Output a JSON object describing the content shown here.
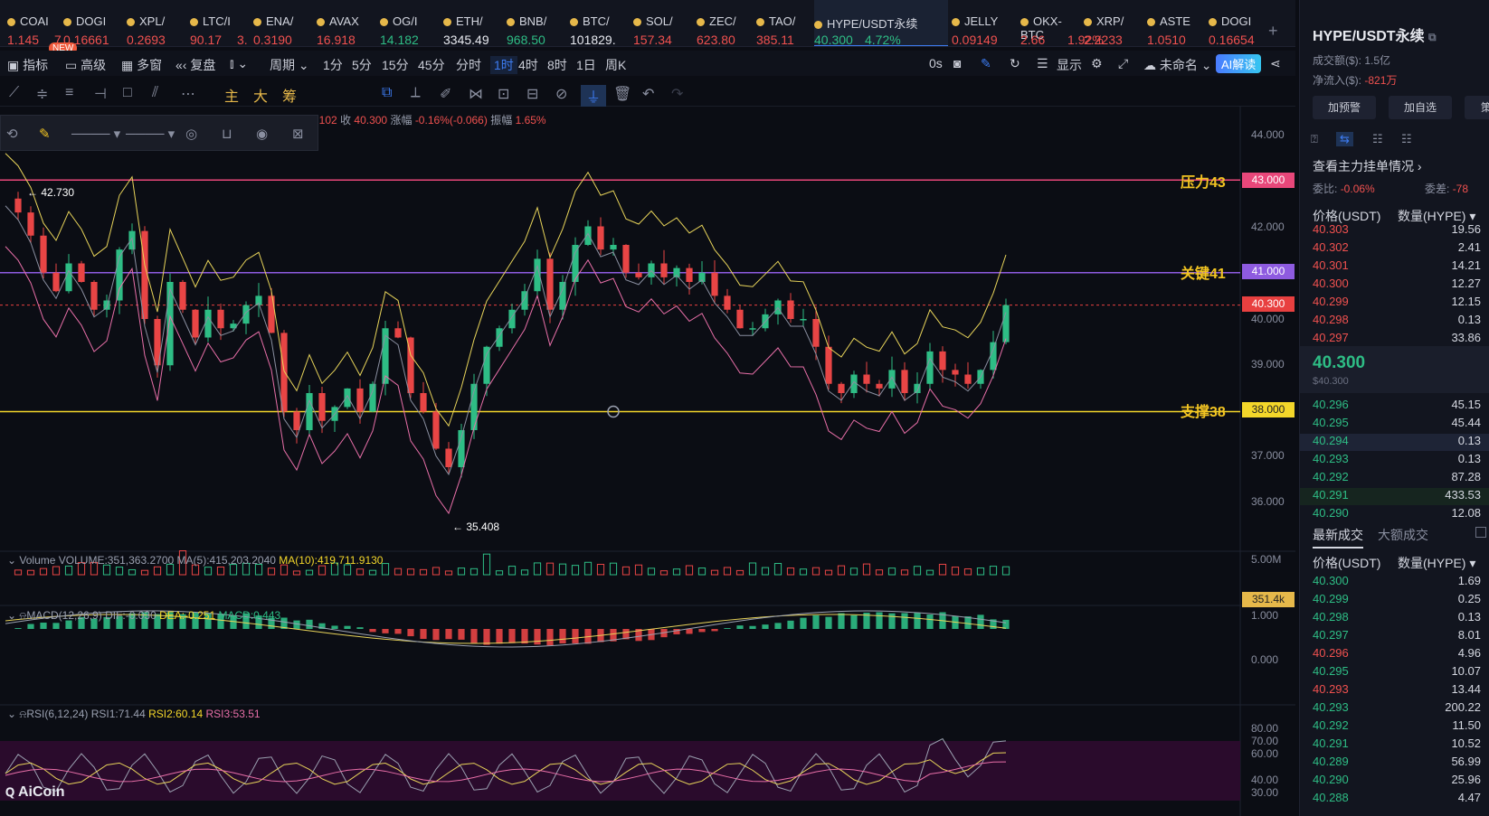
{
  "ticker": [
    {
      "sym": "COAI",
      "price": "1.145",
      "extra": "7",
      "color": "red"
    },
    {
      "sym": "DOGI",
      "price": "0.16661",
      "color": "red"
    },
    {
      "sym": "XPL/",
      "price": "0.2693",
      "color": "red"
    },
    {
      "sym": "LTC/I",
      "price": "90.17",
      "extra": "3.",
      "color": "red"
    },
    {
      "sym": "ENA/",
      "price": "0.3190",
      "color": "red"
    },
    {
      "sym": "AVAX",
      "price": "16.918",
      "color": "red"
    },
    {
      "sym": "OG/I",
      "price": "14.182",
      "color": "green"
    },
    {
      "sym": "ETH/",
      "price": "3345.49",
      "color": "white"
    },
    {
      "sym": "BNB/",
      "price": "968.50",
      "color": "green"
    },
    {
      "sym": "BTC/",
      "price": "101829.",
      "color": "white"
    },
    {
      "sym": "SOL/",
      "price": "157.34",
      "color": "red"
    },
    {
      "sym": "ZEC/",
      "price": "623.80",
      "color": "red"
    },
    {
      "sym": "TAO/",
      "price": "385.11",
      "color": "red"
    },
    {
      "sym": "HYPE/USDT永续",
      "price": "40.300",
      "extra": "4.72%",
      "color": "green",
      "active": true
    },
    {
      "sym": "JELLY",
      "price": "0.09149",
      "color": "red"
    },
    {
      "sym": "OKX-BTC",
      "price": "2.66",
      "extra": "1.92%",
      "color": "red"
    },
    {
      "sym": "XRP/",
      "price": "2.2233",
      "color": "red"
    },
    {
      "sym": "ASTE",
      "price": "1.0510",
      "color": "red"
    },
    {
      "sym": "DOGI",
      "price": "0.16654",
      "color": "red"
    }
  ],
  "new_badge": "NEW",
  "toolbar1": {
    "indicators": "指标",
    "advanced": "高级",
    "multi": "多窗",
    "replay": "复盘",
    "period": "周期",
    "intervals": [
      "1分",
      "5分",
      "15分",
      "45分",
      "分时",
      "1时",
      "4时",
      "8时",
      "1日",
      "周K"
    ],
    "selected_interval": "1时",
    "countdown": "0s",
    "display": "显示",
    "unnamed": "未命名",
    "ai": "AI解读"
  },
  "toolbar2": {
    "main": "主",
    "big": "大",
    "chips": "筹"
  },
  "ohlc": {
    "open": "40.102",
    "close_label": "收",
    "close": "40.300",
    "chg_label": "涨幅",
    "chg": "-0.16%(-0.066)",
    "amp_label": "振幅",
    "amp": "1.65%"
  },
  "levels": [
    {
      "label": "压力43",
      "value": "43.000",
      "color": "#e8477a",
      "price": 43.0
    },
    {
      "label": "关键41",
      "value": "41.000",
      "color": "#8e5be0",
      "price": 41.0
    },
    {
      "label": "支撑38",
      "value": "38.000",
      "color": "#f3d62a",
      "price": 38.0
    }
  ],
  "current_price_tag": "40.300",
  "high_label": "42.730",
  "low_label": "35.408",
  "y_ticks": [
    "44.000",
    "42.000",
    "40.000",
    "39.000",
    "37.000",
    "36.000"
  ],
  "volume": {
    "label": "Volume",
    "text": "VOLUME:351,363.2700",
    "ma5": "MA(5):415,203.2040",
    "ma10": "MA(10):419,711.9130",
    "axis": "5.00M",
    "tag": "351.4k"
  },
  "macd": {
    "label": "MACD(12,26,9)",
    "dif": "DIF:-0.030",
    "dea": "DEA:-0.251",
    "macd": "MACD:0.443",
    "axis_top": "1.000",
    "axis_mid": "0.000"
  },
  "rsi": {
    "label": "RSI(6,12,24)",
    "rsi1": "RSI1:71.44",
    "rsi2": "RSI2:60.14",
    "rsi3": "RSI3:53.51",
    "ticks": [
      "80.00",
      "70.00",
      "60.00",
      "40.00",
      "30.00"
    ]
  },
  "watermark": "AiCoin",
  "right_panel": {
    "title": "HYPE/USDT永续",
    "turnover_label": "成交额($)",
    "turnover": "1.5亿",
    "netflow_label": "净流入($)",
    "netflow": "-821万",
    "btn_alert": "加预警",
    "btn_watch": "加自选",
    "btn_strategy": "策略",
    "mainforce": "查看主力挂单情况",
    "ratio_label": "委比:",
    "ratio": "-0.06%",
    "diff_label": "委差:",
    "diff": "-78",
    "price_hdr": "价格(USDT)",
    "qty_hdr": "数量(HYPE)",
    "asks": [
      [
        "40.303",
        "19.56"
      ],
      [
        "40.302",
        "2.41"
      ],
      [
        "40.301",
        "14.21"
      ],
      [
        "40.300",
        "12.27"
      ],
      [
        "40.299",
        "12.15"
      ],
      [
        "40.298",
        "0.13"
      ],
      [
        "40.297",
        "33.86"
      ]
    ],
    "last_price": "40.300",
    "last_price_usd": "$40.300",
    "bids": [
      [
        "40.296",
        "45.15"
      ],
      [
        "40.295",
        "45.44"
      ],
      [
        "40.294",
        "0.13"
      ],
      [
        "40.293",
        "0.13"
      ],
      [
        "40.292",
        "87.28"
      ],
      [
        "40.291",
        "433.53"
      ],
      [
        "40.290",
        "12.08"
      ]
    ],
    "trades_tab": "最新成交",
    "big_trades_tab": "大额成交",
    "trades": [
      [
        "40.300",
        "1.69",
        "green"
      ],
      [
        "40.299",
        "0.25",
        "green"
      ],
      [
        "40.298",
        "0.13",
        "green"
      ],
      [
        "40.297",
        "8.01",
        "green"
      ],
      [
        "40.296",
        "4.96",
        "red"
      ],
      [
        "40.295",
        "10.07",
        "green"
      ],
      [
        "40.293",
        "13.44",
        "red"
      ],
      [
        "40.293",
        "200.22",
        "green"
      ],
      [
        "40.292",
        "11.50",
        "green"
      ],
      [
        "40.291",
        "10.52",
        "green"
      ],
      [
        "40.289",
        "56.99",
        "green"
      ],
      [
        "40.290",
        "25.96",
        "green"
      ],
      [
        "40.288",
        "4.47",
        "green"
      ]
    ]
  }
}
